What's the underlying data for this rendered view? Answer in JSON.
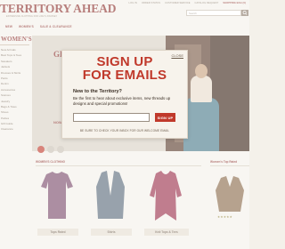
{
  "header": {
    "logo": "TERRITORY AHEAD",
    "tagline": "EXPRESSIVE CLOTHING FOR LIFE'S JOURNEY",
    "utility_links": [
      "LOG IN",
      "ORDER STATUS",
      "CUSTOMER SERVICE",
      "CATALOG REQUEST",
      "SHOPPING BAG (0)"
    ],
    "search_placeholder": "Search"
  },
  "nav": {
    "items": [
      "NEW",
      "WOMEN'S",
      "SALE & CLEARANCE"
    ]
  },
  "sidebar": {
    "title": "WOMEN'S",
    "items": [
      "New Arrivals",
      "Best Tops & Tees",
      "Sweaters",
      "Jackets",
      "Dresses & Skirts",
      "Pants",
      "Denim",
      "Accessories",
      "Scarves",
      "Jewelry",
      "Bags & Totes",
      "Shoes",
      "Petites",
      "Gift Guide",
      "Clearance"
    ]
  },
  "hero": {
    "headline": "GE",
    "subline": "NOW"
  },
  "sections": {
    "left": "WOMEN'S CLOTHING",
    "right": "Women's Top Rated"
  },
  "products": [
    {
      "label": "Tops Rated",
      "color": "#7a4a6a"
    },
    {
      "label": "Shirts",
      "color": "#5a6a7a"
    },
    {
      "label": "Knit Tops & Tees",
      "color": "#9a2e4a"
    }
  ],
  "rated_product": {
    "color": "#8a6a4a",
    "stars": "★★★★★"
  },
  "popup": {
    "close_label": "CLOSE",
    "headline_line1": "SIGN UP",
    "headline_line2": "FOR EMAILS",
    "question": "New to the Territory?",
    "body": "Be the first to hear about exclusive items, new threads up designs and special promotions!",
    "email_placeholder": "",
    "button_label": "SIGN UP",
    "fine_print": "BE SURE TO CHECK YOUR INBOX FOR OUR WELCOME EMAIL",
    "accent_color": "#c0392b"
  }
}
